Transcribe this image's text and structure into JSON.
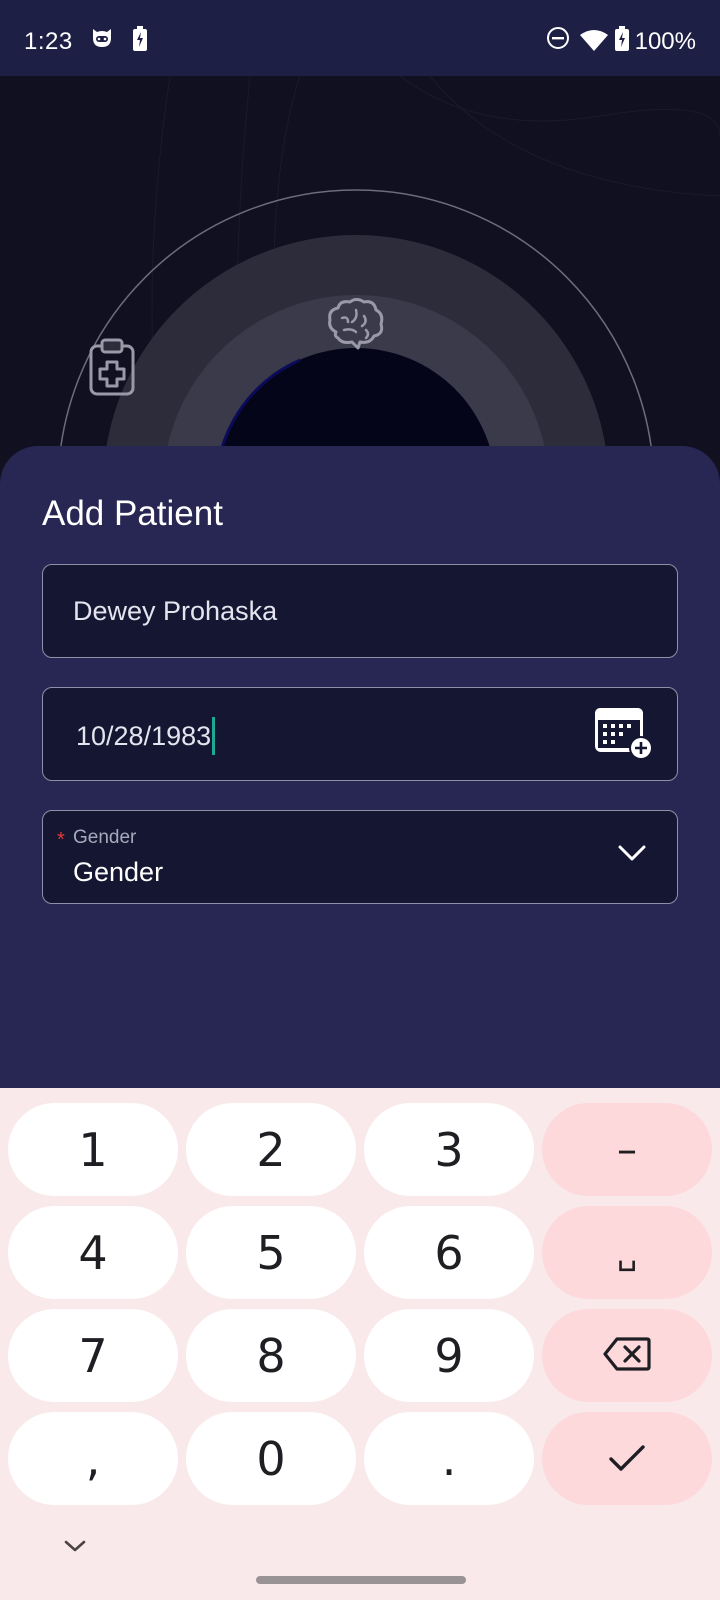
{
  "status_bar": {
    "time": "1:23",
    "battery_text": "100%",
    "left_icons": [
      "cat-face-icon",
      "battery-saver-icon"
    ],
    "right_icons": [
      "do-not-disturb-icon",
      "wifi-icon",
      "battery-charging-icon"
    ]
  },
  "hero": {
    "icons": [
      "clipboard-medical-icon",
      "brain-icon"
    ]
  },
  "sheet": {
    "title": "Add Patient",
    "name_field": {
      "value": "Dewey Prohaska"
    },
    "dob_field": {
      "value": "10/28/1983",
      "icon": "calendar-add-icon"
    },
    "gender_field": {
      "required_mark": "*",
      "label": "Gender",
      "value": "Gender",
      "icon": "chevron-down-icon"
    }
  },
  "keyboard": {
    "keys": [
      {
        "label": "1"
      },
      {
        "label": "2"
      },
      {
        "label": "3"
      },
      {
        "label": "–"
      },
      {
        "label": "4"
      },
      {
        "label": "5"
      },
      {
        "label": "6"
      },
      {
        "label": "␣"
      },
      {
        "label": "7"
      },
      {
        "label": "8"
      },
      {
        "label": "9"
      },
      {
        "label": "",
        "icon": "backspace-icon"
      },
      {
        "label": ","
      },
      {
        "label": "0"
      },
      {
        "label": "."
      },
      {
        "label": "",
        "icon": "checkmark-icon"
      }
    ],
    "hide_icon": "chevron-down-icon"
  },
  "colors": {
    "sheet_bg": "#282653",
    "field_bg": "#151632",
    "accent_caret": "#1ea896",
    "required": "#e53935",
    "keyboard_bg": "#fae9ea",
    "key_fn_bg": "#fdd9dc"
  }
}
